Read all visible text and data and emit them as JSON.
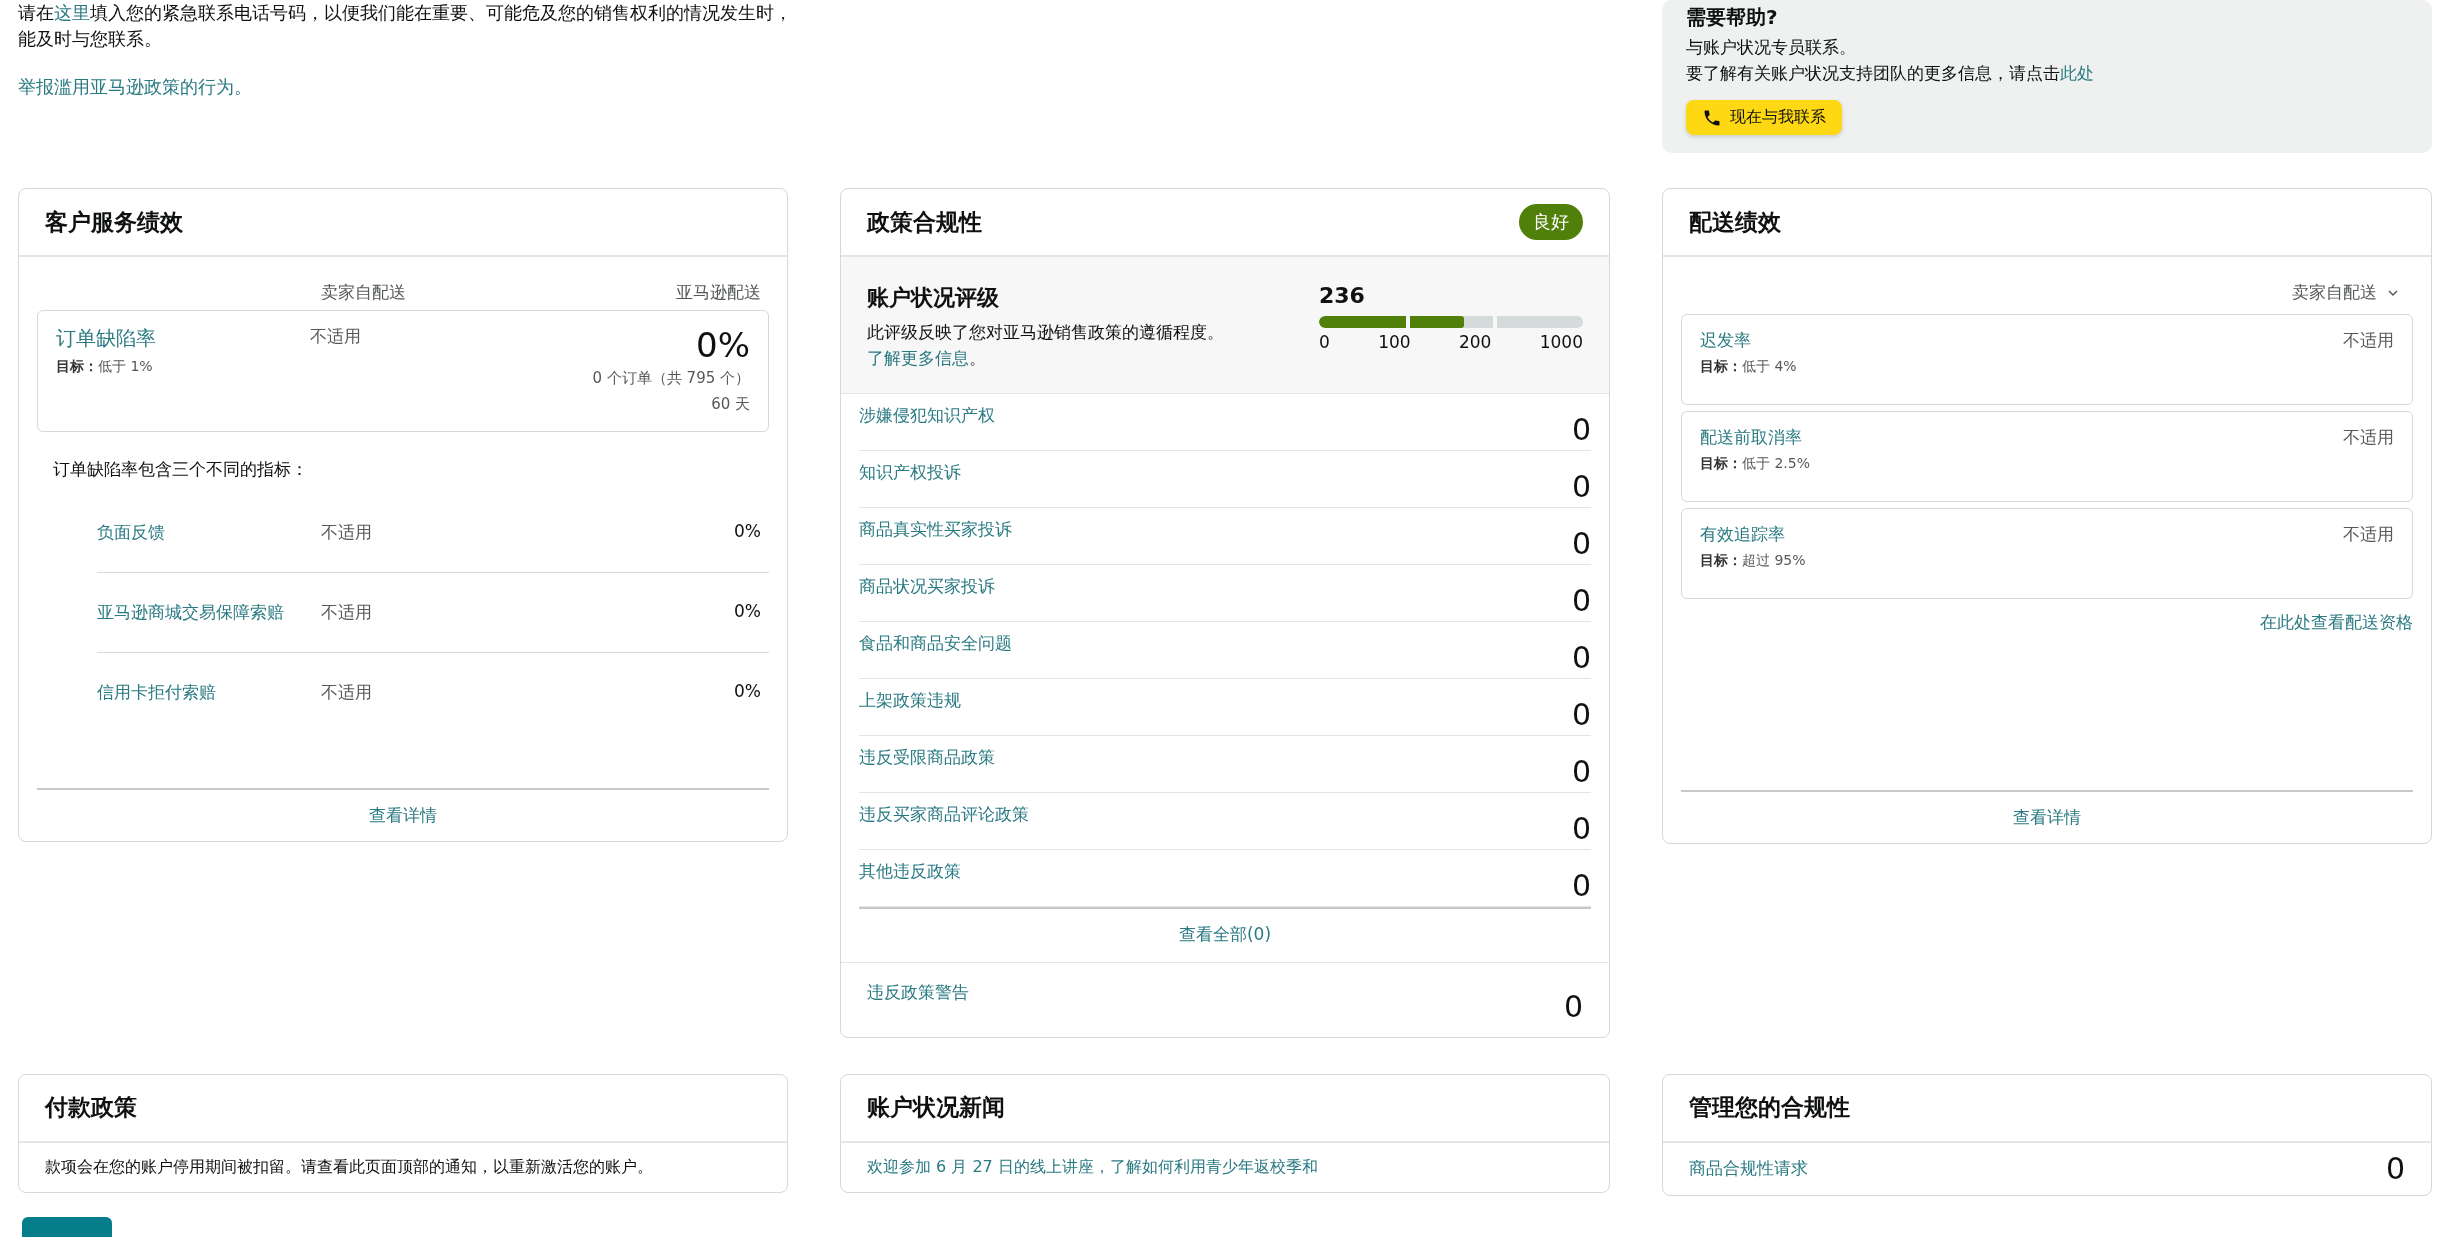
{
  "notice": {
    "text_before": "请在",
    "link": "这里",
    "text_after": "填入您的紧急联系电话号码，以便我们能在重要、可能危及您的销售权利的情况发生时，能及时与您联系。",
    "report_link": "举报滥用亚马逊政策的行为。"
  },
  "help": {
    "title": "需要帮助?",
    "line_1": "与账户状况专员联系。",
    "line_2": "要了解有关账户状况支持团队的更多信息，请点击",
    "link": "此处",
    "button": "现在与我联系"
  },
  "customer_service": {
    "title": "客户服务绩效",
    "columns": [
      "卖家自配送",
      "亚马逊配送"
    ],
    "main_metric": {
      "name": "订单缺陷率",
      "target_label": "目标：",
      "target": "低于 1%",
      "seller_value": "不适用",
      "value": "0%",
      "detail": "0 个订单（共 795 个）",
      "period": "60 天"
    },
    "intro": "订单缺陷率包含三个不同的指标：",
    "metrics": [
      {
        "name": "负面反馈",
        "seller_value": "不适用",
        "value": "0%"
      },
      {
        "name": "亚马逊商城交易保障索赔",
        "seller_value": "不适用",
        "value": "0%"
      },
      {
        "name": "信用卡拒付索赔",
        "seller_value": "不适用",
        "value": "0%"
      }
    ],
    "footer_link": "查看详情"
  },
  "policy": {
    "title": "政策合规性",
    "badge": "良好",
    "rating": {
      "title": "账户状况评级",
      "description": "此评级反映了您对亚马逊销售政策的遵循程度。",
      "link": "了解更多信息",
      "end": "。",
      "score": "236",
      "level": 0.55,
      "ticks": [
        "0",
        "100",
        "200",
        "1000"
      ]
    },
    "items": [
      {
        "name": "涉嫌侵犯知识产权",
        "count": "0"
      },
      {
        "name": "知识产权投诉",
        "count": "0"
      },
      {
        "name": "商品真实性买家投诉",
        "count": "0"
      },
      {
        "name": "商品状况买家投诉",
        "count": "0"
      },
      {
        "name": "食品和商品安全问题",
        "count": "0"
      },
      {
        "name": "上架政策违规",
        "count": "0"
      },
      {
        "name": "违反受限商品政策",
        "count": "0"
      },
      {
        "name": "违反买家商品评论政策",
        "count": "0"
      },
      {
        "name": "其他违反政策",
        "count": "0"
      }
    ],
    "view_all": "查看全部(0)",
    "warning": {
      "name": "违反政策警告",
      "count": "0"
    }
  },
  "shipping": {
    "title": "配送绩效",
    "selector": "卖家自配送",
    "metrics": [
      {
        "name": "迟发率",
        "target_label": "目标：",
        "target": "低于 4%",
        "value": "不适用"
      },
      {
        "name": "配送前取消率",
        "target_label": "目标：",
        "target": "低于 2.5%",
        "value": "不适用"
      },
      {
        "name": "有效追踪率",
        "target_label": "目标：",
        "target": "超过 95%",
        "value": "不适用"
      }
    ],
    "eligibility_link": "在此处查看配送资格",
    "footer_link": "查看详情"
  },
  "payment": {
    "title": "付款政策",
    "text": "款项会在您的账户停用期间被扣留。请查看此页面顶部的通知，以重新激活您的账户。"
  },
  "news": {
    "title": "账户状况新闻",
    "items": [
      {
        "headline": "欢迎参加 6 月 27 日的线上讲座，了解如何利用青少年返校季和"
      }
    ]
  },
  "manage": {
    "title": "管理您的合规性",
    "items": [
      {
        "name": "商品合规性请求",
        "count": "0"
      }
    ]
  }
}
